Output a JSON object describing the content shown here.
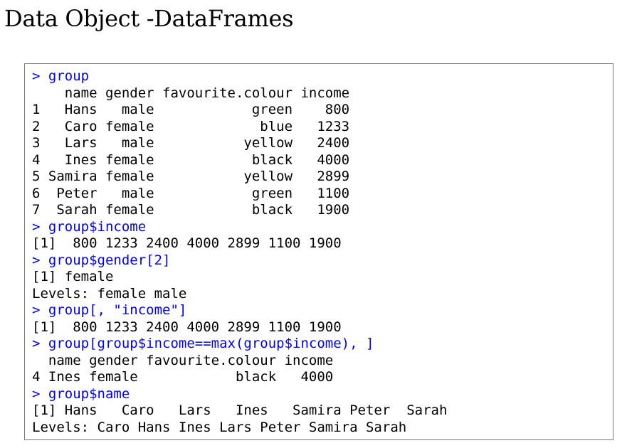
{
  "page": {
    "title": "Data Object -DataFrames"
  },
  "colors": {
    "input": "#0000ff",
    "output": "#000000",
    "border": "#7a7a7a"
  },
  "console": {
    "lines": [
      {
        "kind": "input",
        "text": "> group"
      },
      {
        "kind": "output",
        "text": "    name gender favourite.colour income"
      },
      {
        "kind": "output",
        "text": "1   Hans   male            green    800"
      },
      {
        "kind": "output",
        "text": "2   Caro female             blue   1233"
      },
      {
        "kind": "output",
        "text": "3   Lars   male           yellow   2400"
      },
      {
        "kind": "output",
        "text": "4   Ines female            black   4000"
      },
      {
        "kind": "output",
        "text": "5 Samira female           yellow   2899"
      },
      {
        "kind": "output",
        "text": "6  Peter   male            green   1100"
      },
      {
        "kind": "output",
        "text": "7  Sarah female            black   1900"
      },
      {
        "kind": "input",
        "text": "> group$income"
      },
      {
        "kind": "output",
        "text": "[1]  800 1233 2400 4000 2899 1100 1900"
      },
      {
        "kind": "input",
        "text": "> group$gender[2]"
      },
      {
        "kind": "output",
        "text": "[1] female"
      },
      {
        "kind": "output",
        "text": "Levels: female male"
      },
      {
        "kind": "input",
        "text": "> group[, \"income\"]"
      },
      {
        "kind": "output",
        "text": "[1]  800 1233 2400 4000 2899 1100 1900"
      },
      {
        "kind": "input",
        "text": "> group[group$income==max(group$income), ]"
      },
      {
        "kind": "output",
        "text": "  name gender favourite.colour income"
      },
      {
        "kind": "output",
        "text": "4 Ines female            black   4000"
      },
      {
        "kind": "input",
        "text": "> group$name"
      },
      {
        "kind": "output",
        "text": "[1] Hans   Caro   Lars   Ines   Samira Peter  Sarah"
      },
      {
        "kind": "output",
        "text": "Levels: Caro Hans Ines Lars Peter Samira Sarah"
      }
    ]
  }
}
